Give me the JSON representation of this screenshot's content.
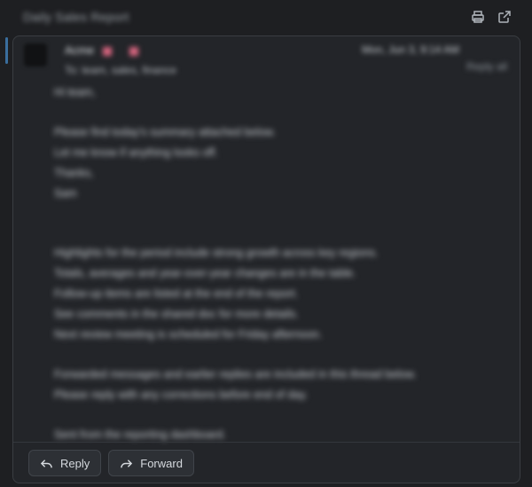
{
  "topbar": {
    "title": "Daily Sales Report",
    "print_icon": "printer-icon",
    "popout_icon": "external-link-icon"
  },
  "message": {
    "sender": "Acme",
    "recipients": "To: team, sales, finance",
    "date": "Mon, Jun 3, 9:14 AM",
    "header_right": "Reply all",
    "body": [
      "Hi team,",
      "",
      "Please find today's summary attached below.",
      "Let me know if anything looks off.",
      "Thanks,",
      "Sam",
      "",
      "",
      "Highlights for the period include strong growth across key regions.",
      "Totals, averages and year-over-year changes are in the table.",
      "Follow-up items are listed at the end of the report.",
      "See comments in the shared doc for more details.",
      "Next review meeting is scheduled for Friday afternoon.",
      "",
      "Forwarded messages and earlier replies are included in this thread below.",
      "Please reply with any corrections before end of day.",
      "",
      "Sent from the reporting dashboard."
    ]
  },
  "actions": {
    "reply_label": "Reply",
    "forward_label": "Forward",
    "reply_icon": "reply-icon",
    "forward_icon": "forward-icon"
  },
  "colors": {
    "background": "#1e1f22",
    "card": "#232529",
    "accent": "#3a6e9e",
    "pink": "#d96680"
  }
}
